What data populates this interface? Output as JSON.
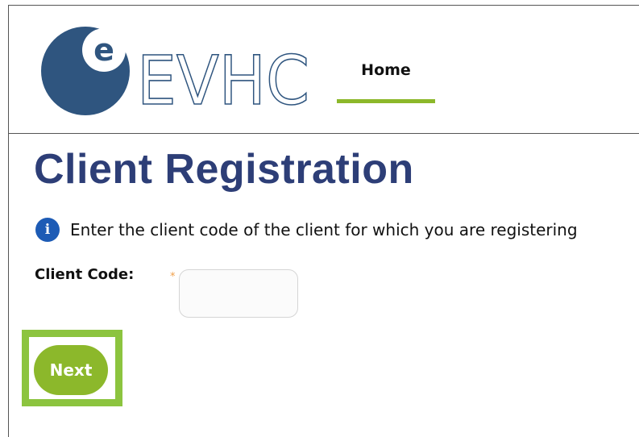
{
  "brand": {
    "logo_letter": "e",
    "logo_text": "EVHC",
    "colors": {
      "logo_blue": "#2f557f",
      "accent_green": "#8cb82b",
      "title_navy": "#2d3e77"
    }
  },
  "nav": {
    "home_label": "Home"
  },
  "page": {
    "title": "Client Registration"
  },
  "info": {
    "icon": "info-icon",
    "icon_glyph": "i",
    "message": "Enter the client code of the client for which you are registering"
  },
  "form": {
    "client_code_label": "Client Code:",
    "required_marker": "*",
    "client_code_value": "",
    "client_code_placeholder": ""
  },
  "actions": {
    "next_label": "Next"
  }
}
